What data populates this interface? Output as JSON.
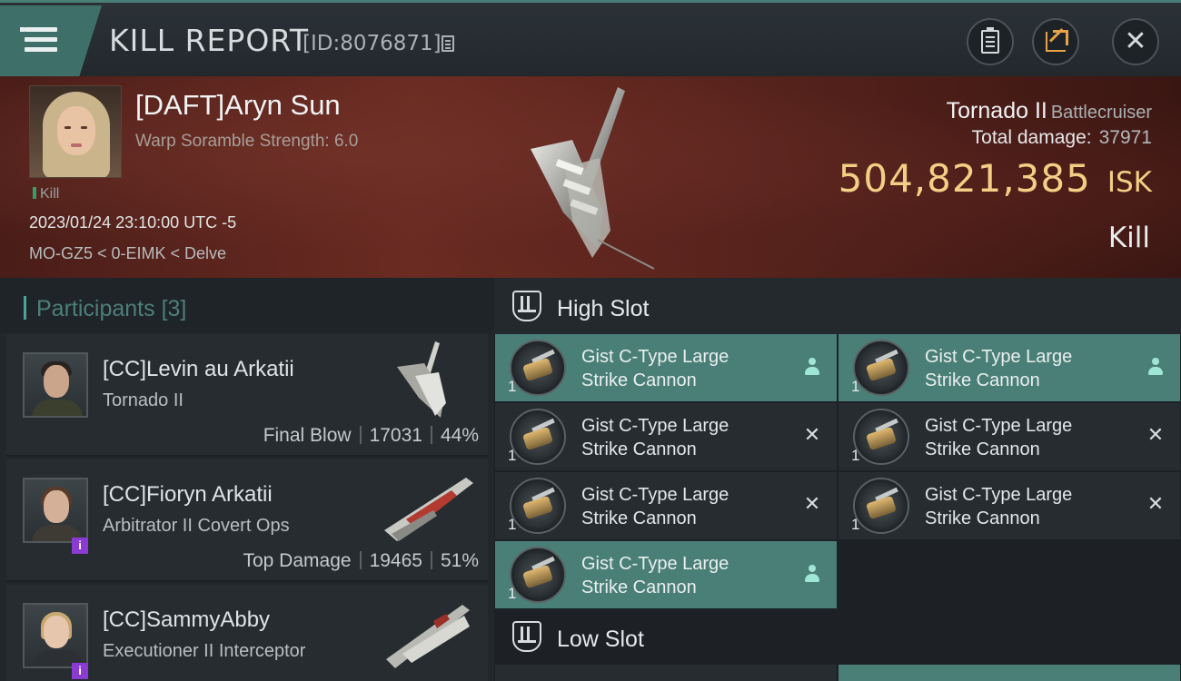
{
  "header": {
    "title": "KILL REPORT",
    "kill_id": "[ID:8076871]"
  },
  "victim": {
    "name": "[DAFT]Aryn Sun",
    "warp_scramble": "Warp Soramble Strength: 6.0",
    "kill_tag": "Kill",
    "datetime": "2023/01/24 23:10:00 UTC -5",
    "location": "MO-GZ5 < 0-EIMK < Delve",
    "ship_name": "Tornado II",
    "ship_class": "Battlecruiser",
    "total_damage_label": "Total damage:",
    "total_damage": "37971",
    "isk_value": "504,821,385",
    "isk_unit": "ISK",
    "result": "Kill"
  },
  "participants": {
    "title": "Participants",
    "count": "[3]",
    "list": [
      {
        "name": "[CC]Levin au Arkatii",
        "ship": "Tornado II",
        "stat_label": "Final Blow",
        "damage": "17031",
        "percent": "44%"
      },
      {
        "name": "[CC]Fioryn Arkatii",
        "ship": "Arbitrator II Covert Ops",
        "stat_label": "Top Damage",
        "damage": "19465",
        "percent": "51%"
      },
      {
        "name": "[CC]SammyAbby",
        "ship": "Executioner II Interceptor"
      }
    ]
  },
  "fitting": {
    "high_slot_title": "High Slot",
    "low_slot_title": "Low Slot",
    "high_modules": [
      {
        "line1": "Gist C-Type Large",
        "line2": "Strike Cannon",
        "qty": "1",
        "status": "dropped"
      },
      {
        "line1": "Gist C-Type Large",
        "line2": "Strike Cannon",
        "qty": "1",
        "status": "dropped"
      },
      {
        "line1": "Gist C-Type Large",
        "line2": "Strike Cannon",
        "qty": "1",
        "status": "destroyed"
      },
      {
        "line1": "Gist C-Type Large",
        "line2": "Strike Cannon",
        "qty": "1",
        "status": "destroyed"
      },
      {
        "line1": "Gist C-Type Large",
        "line2": "Strike Cannon",
        "qty": "1",
        "status": "destroyed"
      },
      {
        "line1": "Gist C-Type Large",
        "line2": "Strike Cannon",
        "qty": "1",
        "status": "destroyed"
      },
      {
        "line1": "Gist C-Type Large",
        "line2": "Strike Cannon",
        "qty": "1",
        "status": "dropped"
      }
    ],
    "status_glyphs": {
      "destroyed": "✕"
    }
  },
  "colors": {
    "accent_teal": "#4a7f78",
    "isk_gold": "#f2cf84",
    "share_orange": "#e8a24a",
    "info_purple": "#8a3bd1"
  },
  "icons": {
    "menu": "hamburger-icon",
    "copy": "copy-icon",
    "clipboard": "clipboard-icon",
    "share": "share-icon",
    "close": "close-icon",
    "slot": "slot-icon",
    "dropped": "person-icon",
    "destroyed": "x-icon"
  }
}
